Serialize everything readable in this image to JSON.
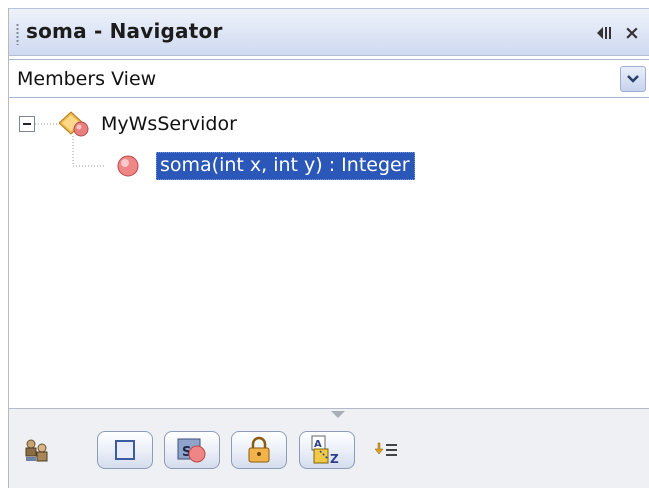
{
  "window": {
    "title": "soma - Navigator"
  },
  "view_selector": {
    "selected": "Members View"
  },
  "tree": {
    "root": {
      "label": "MyWsServidor",
      "icon": "class-icon",
      "expanded": true
    },
    "children": [
      {
        "label": "soma(int x, int y) : Integer",
        "icon": "method-icon",
        "selected": true
      }
    ]
  },
  "toolbar": {
    "buttons": [
      {
        "icon": "inherited-members-icon"
      },
      {
        "icon": "show-fields-icon"
      },
      {
        "icon": "show-static-icon"
      },
      {
        "icon": "show-non-public-icon"
      },
      {
        "icon": "sort-by-name-icon"
      },
      {
        "icon": "sort-by-source-icon"
      }
    ]
  },
  "colors": {
    "selection": "#2a57b8",
    "titlebar": "#dde5f5",
    "method_dot": "#f08080"
  }
}
